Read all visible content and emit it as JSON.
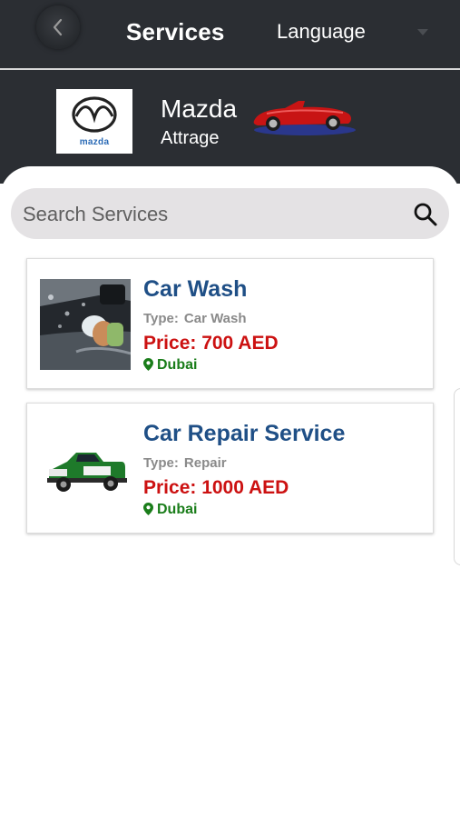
{
  "header": {
    "title": "Services",
    "language_label": "Language"
  },
  "vehicle": {
    "brand": "Mazda",
    "model": "Attrage",
    "logo_text": "mazda"
  },
  "search": {
    "placeholder": "Search Services"
  },
  "services": [
    {
      "title": "Car Wash",
      "type_label": "Type:",
      "type_value": "Car Wash",
      "price": "Price: 700 AED",
      "location": "Dubai",
      "thumbnail_icon": "car-wash-photo"
    },
    {
      "title": "Car Repair Service",
      "type_label": "Type:",
      "type_value": "Repair",
      "price": "Price: 1000 AED",
      "location": "Dubai",
      "thumbnail_icon": "pickup-truck-photo"
    }
  ],
  "colors": {
    "header_bg": "#2b2e33",
    "title_blue": "#1f4f86",
    "price_red": "#cc1111",
    "location_green": "#1a7d1a",
    "search_bg": "#e4e2e4"
  }
}
